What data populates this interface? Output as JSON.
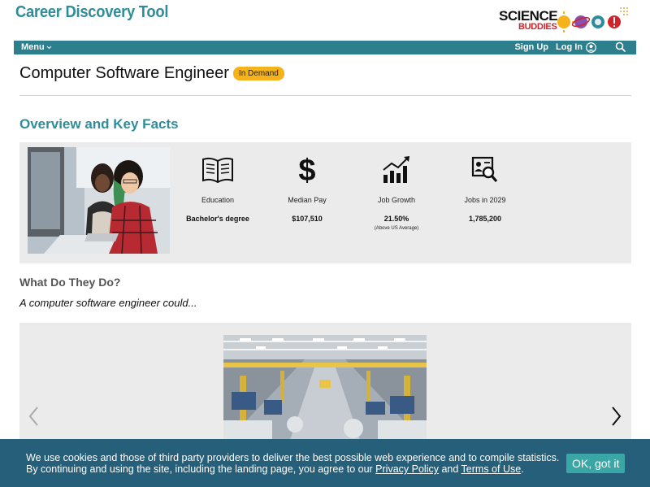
{
  "site": {
    "title": "Career Discovery Tool",
    "logo_line1": "SCIENCE",
    "logo_line2": "BUDDIES"
  },
  "nav": {
    "menu_label": "Menu",
    "sign_up": "Sign Up",
    "log_in": "Log In"
  },
  "career": {
    "title": "Computer Software Engineer",
    "badge": "In Demand"
  },
  "overview": {
    "heading": "Overview and Key Facts",
    "facts": [
      {
        "label": "Education",
        "value": "Bachelor's degree",
        "icon": "book-icon"
      },
      {
        "label": "Median Pay",
        "value": "$107,510",
        "icon": "dollar-icon"
      },
      {
        "label": "Job Growth",
        "value": "21.50%",
        "note": "(Above US Average)",
        "icon": "growth-chart-icon"
      },
      {
        "label": "Jobs in 2029",
        "value": "1,785,200",
        "icon": "job-search-icon"
      }
    ]
  },
  "duties": {
    "heading": "What Do They Do?",
    "lead": "A computer software engineer could..."
  },
  "cookie": {
    "line1": "We use cookies and those of third party providers to deliver the best possible web experience and to compile statistics.",
    "line2_pre": "By continuing and using the site, including the landing page, you agree to our ",
    "privacy": "Privacy Policy",
    "and": " and ",
    "terms": "Terms of Use",
    "end": ".",
    "ok": "OK, got it"
  },
  "colors": {
    "brand": "#2f8c9a",
    "nav_bg": "#2d7f8d",
    "badge": "#f6b21a",
    "cookie_bg": "#255f79",
    "ok_button": "#3aa6a5"
  }
}
